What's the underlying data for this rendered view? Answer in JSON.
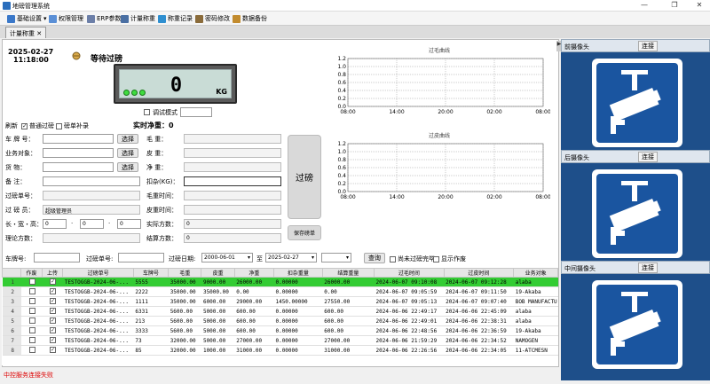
{
  "window": {
    "title": "地磅管理系统",
    "minimize": "—",
    "maximize": "❐",
    "close": "✕"
  },
  "menu": [
    {
      "label": "基础设置",
      "suffix": "▾",
      "color": "#3a78c9"
    },
    {
      "label": "权限管理",
      "suffix": "",
      "color": "#5a8fd6"
    },
    {
      "label": "ERP参数",
      "suffix": "",
      "color": "#6c7fa8"
    },
    {
      "label": "计量称重",
      "suffix": "",
      "color": "#4a6fa3"
    },
    {
      "label": "称重记录",
      "suffix": "",
      "color": "#2f8fd0"
    },
    {
      "label": "密码修改",
      "suffix": "",
      "color": "#8a6b3a"
    },
    {
      "label": "数据备份",
      "suffix": "",
      "color": "#c28b2e"
    }
  ],
  "tab": {
    "label": "计量称重",
    "close": "✕"
  },
  "status": {
    "date": "2025-02-27",
    "time": "11:18:00",
    "text": "等待过磅"
  },
  "display": {
    "value": "0",
    "unit": "KG"
  },
  "debug": {
    "label": "调试模式",
    "value": ""
  },
  "options": {
    "refresh": "刷新",
    "normal": "普通过磅",
    "normal_checked": true,
    "single": "磅单补录",
    "single_checked": false
  },
  "net": {
    "label": "实时净重：",
    "value": "0"
  },
  "form_left": [
    {
      "label": "车 牌 号：",
      "value": "",
      "btn": "选择"
    },
    {
      "label": "业务对象：",
      "value": "",
      "btn": "选择"
    },
    {
      "label": "货    物：",
      "value": "",
      "btn": "选择"
    },
    {
      "label": "备    注：",
      "value": "",
      "btn": ""
    },
    {
      "label": "过磅单号：",
      "value": "",
      "btn": ""
    },
    {
      "label": "过 磅 员：",
      "value": "超级管理员",
      "btn": ""
    }
  ],
  "dims": {
    "label": "长・宽・高：",
    "l": "0",
    "w": "0",
    "h": "0",
    "sep": "·"
  },
  "theory": {
    "label": "理论方数："
  },
  "form_right": [
    {
      "label": "毛    重：",
      "value": ""
    },
    {
      "label": "皮    重：",
      "value": ""
    },
    {
      "label": "净    重：",
      "value": ""
    },
    {
      "label": "扣杂(KG)：",
      "value": ""
    },
    {
      "label": "毛重时间：",
      "value": ""
    },
    {
      "label": "皮重时间：",
      "value": ""
    },
    {
      "label": "实际方数：",
      "value": "0"
    },
    {
      "label": "结算方数：",
      "value": "0"
    }
  ],
  "buttons": {
    "weigh": "过磅",
    "save": "保存磅单"
  },
  "charts": [
    {
      "title": "过毛曲线",
      "yticks": [
        "1.2",
        "1.0",
        "0.8",
        "0.6",
        "0.4",
        "0.2",
        "0.0"
      ],
      "xticks": [
        "08:00",
        "14:00",
        "20:00",
        "02:00",
        "08:00"
      ]
    },
    {
      "title": "过皮曲线",
      "yticks": [
        "1.2",
        "1.0",
        "0.8",
        "0.6",
        "0.4",
        "0.2",
        "0.0"
      ],
      "xticks": [
        "08:00",
        "14:00",
        "20:00",
        "02:00",
        "08:00"
      ]
    }
  ],
  "filter": {
    "plate_label": "车牌号:",
    "plate": "",
    "no_label": "过磅单号:",
    "no": "",
    "date_label": "过磅日期:",
    "from": "2000-06-01",
    "to_label": "至",
    "to": "2025-02-27",
    "query": "查询",
    "unfinished": "尚未过磅完毕",
    "show_void": "显示作废"
  },
  "table": {
    "columns": [
      "作废",
      "上传",
      "过磅单号",
      "车牌号",
      "毛重",
      "皮重",
      "净重",
      "扣杂重量",
      "结算重量",
      "过毛时间",
      "过皮时间",
      "业务对象"
    ],
    "rows": [
      {
        "n": "1",
        "void": false,
        "up": true,
        "no": "TESTOGGB-2024-06-...",
        "plate": "5555",
        "gross": "35000.00",
        "tare": "9000.00",
        "net": "26000.00",
        "ded": "0.00000",
        "settle": "26000.00",
        "tg": "2024-06-07 09:10:08",
        "tt": "2024-06-07 09:12:28",
        "obj": "alaba",
        "sel": true
      },
      {
        "n": "2",
        "void": false,
        "up": true,
        "no": "TESTOGGB-2024-06-...",
        "plate": "2222",
        "gross": "35000.00",
        "tare": "35000.00",
        "net": "0.00",
        "ded": "0.00000",
        "settle": "0.00",
        "tg": "2024-06-07 09:05:59",
        "tt": "2024-06-07 09:11:50",
        "obj": "19-Akaba",
        "sel": false
      },
      {
        "n": "3",
        "void": false,
        "up": true,
        "no": "TESTOGGB-2024-06-...",
        "plate": "1111",
        "gross": "35000.00",
        "tare": "6000.00",
        "net": "29000.00",
        "ded": "1450.00000",
        "settle": "27550.00",
        "tg": "2024-06-07 09:05:13",
        "tt": "2024-06-07 09:07:40",
        "obj": "BOB MANUFACTU",
        "sel": false
      },
      {
        "n": "4",
        "void": false,
        "up": true,
        "no": "TESTOGGB-2024-06-...",
        "plate": "6331",
        "gross": "5600.00",
        "tare": "5000.00",
        "net": "600.00",
        "ded": "0.00000",
        "settle": "600.00",
        "tg": "2024-06-06 22:49:17",
        "tt": "2024-06-06 22:45:09",
        "obj": "alaba",
        "sel": false
      },
      {
        "n": "5",
        "void": false,
        "up": true,
        "no": "TESTOGGB-2024-06-...",
        "plate": "213",
        "gross": "5600.00",
        "tare": "5000.00",
        "net": "600.00",
        "ded": "0.00000",
        "settle": "600.00",
        "tg": "2024-06-06 22:49:01",
        "tt": "2024-06-06 22:38:31",
        "obj": "alaba",
        "sel": false
      },
      {
        "n": "6",
        "void": false,
        "up": true,
        "no": "TESTOGGB-2024-06-...",
        "plate": "3333",
        "gross": "5600.00",
        "tare": "5000.00",
        "net": "600.00",
        "ded": "0.00000",
        "settle": "600.00",
        "tg": "2024-06-06 22:48:56",
        "tt": "2024-06-06 22:36:59",
        "obj": "19-Akaba",
        "sel": false
      },
      {
        "n": "7",
        "void": false,
        "up": true,
        "no": "TESTOGGB-2024-06-...",
        "plate": "73",
        "gross": "32000.00",
        "tare": "5000.00",
        "net": "27000.00",
        "ded": "0.00000",
        "settle": "27000.00",
        "tg": "2024-06-06 21:59:29",
        "tt": "2024-06-06 22:34:52",
        "obj": "NAMOGEN",
        "sel": false
      },
      {
        "n": "8",
        "void": false,
        "up": true,
        "no": "TESTOGGB-2024-06-...",
        "plate": "85",
        "gross": "32000.00",
        "tare": "1000.00",
        "net": "31000.00",
        "ded": "0.00000",
        "settle": "31000.00",
        "tg": "2024-06-06 22:26:56",
        "tt": "2024-06-06 22:34:05",
        "obj": "11-ATCMESN",
        "sel": false
      }
    ]
  },
  "cameras": [
    {
      "title": "前摄像头",
      "btn": "连接"
    },
    {
      "title": "后摄像头",
      "btn": "连接"
    },
    {
      "title": "中间摄像头",
      "btn": "连接"
    }
  ],
  "statusbar": {
    "text": "中控服务连接失败"
  },
  "colors": {
    "accent": "#1e4f8a",
    "selected_row": "#33cc33",
    "error": "#dd0000"
  }
}
